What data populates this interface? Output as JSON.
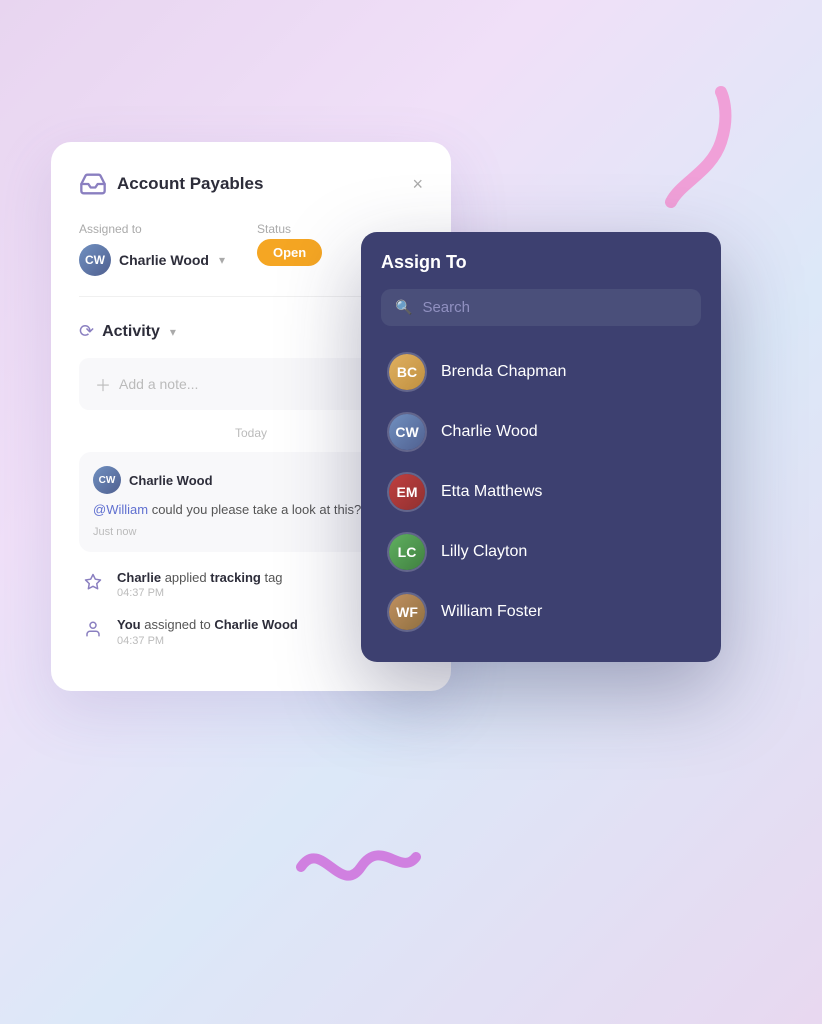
{
  "page": {
    "background": "lavender gradient"
  },
  "main_card": {
    "title": "Account Payables",
    "close_label": "×",
    "assigned_to_label": "Assigned to",
    "status_label": "Status",
    "assigned_user": "Charlie Wood",
    "status_badge": "Open",
    "activity_title": "Activity",
    "add_note_placeholder": "Add a note...",
    "today_label": "Today",
    "comment": {
      "user": "Charlie Wood",
      "mention": "@William",
      "text": " could you please take a look at this?\"",
      "time": "Just now"
    },
    "activity_items": [
      {
        "user": "Charlie",
        "action": " applied ",
        "bold": "tracking",
        "suffix": " tag",
        "time": "04:37 PM"
      },
      {
        "user": "You",
        "action": " assigned to ",
        "bold": "Charlie Wood",
        "suffix": "",
        "time": "04:37 PM"
      }
    ]
  },
  "assign_dropdown": {
    "title": "Assign To",
    "search_placeholder": "Search",
    "users": [
      {
        "name": "Brenda Chapman",
        "initials": "BC",
        "color1": "#e0b060",
        "color2": "#c09040"
      },
      {
        "name": "Charlie Wood",
        "initials": "CW",
        "color1": "#7090c0",
        "color2": "#506090"
      },
      {
        "name": "Etta Matthews",
        "initials": "EM",
        "color1": "#c04040",
        "color2": "#903030"
      },
      {
        "name": "Lilly Clayton",
        "initials": "LC",
        "color1": "#60b060",
        "color2": "#408040"
      },
      {
        "name": "William Foster",
        "initials": "WF",
        "color1": "#c09060",
        "color2": "#907040"
      }
    ]
  }
}
